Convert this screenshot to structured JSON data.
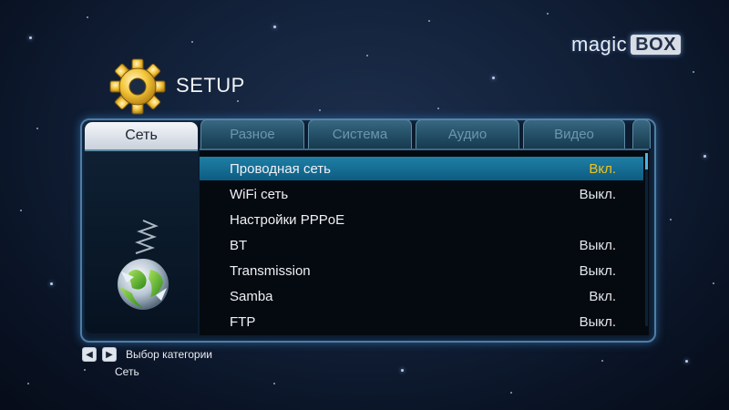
{
  "brand": {
    "part1": "magic",
    "part2": "BOX"
  },
  "header": {
    "title": "SETUP",
    "icon": "gear-icon"
  },
  "tabs": [
    {
      "label": "Сеть",
      "active": true
    },
    {
      "label": "Разное",
      "active": false
    },
    {
      "label": "Система",
      "active": false
    },
    {
      "label": "Аудио",
      "active": false
    },
    {
      "label": "Видео",
      "active": false
    }
  ],
  "settings": [
    {
      "label": "Проводная сеть",
      "value": "Вкл.",
      "selected": true
    },
    {
      "label": "WiFi сеть",
      "value": "Выкл.",
      "selected": false
    },
    {
      "label": "Настройки PPPoE",
      "value": "",
      "selected": false
    },
    {
      "label": "BT",
      "value": "Выкл.",
      "selected": false
    },
    {
      "label": "Transmission",
      "value": "Выкл.",
      "selected": false
    },
    {
      "label": "Samba",
      "value": "Вкл.",
      "selected": false
    },
    {
      "label": "FTP",
      "value": "Выкл.",
      "selected": false
    }
  ],
  "footer": {
    "hint": "Выбор категории",
    "crumb": "Сеть",
    "left_key": "◀",
    "right_key": "▶"
  },
  "colors": {
    "selected_row": "#1a759e",
    "selected_value": "#f0c41e",
    "panel_border": "#4f7da6",
    "background": "#13223b"
  }
}
